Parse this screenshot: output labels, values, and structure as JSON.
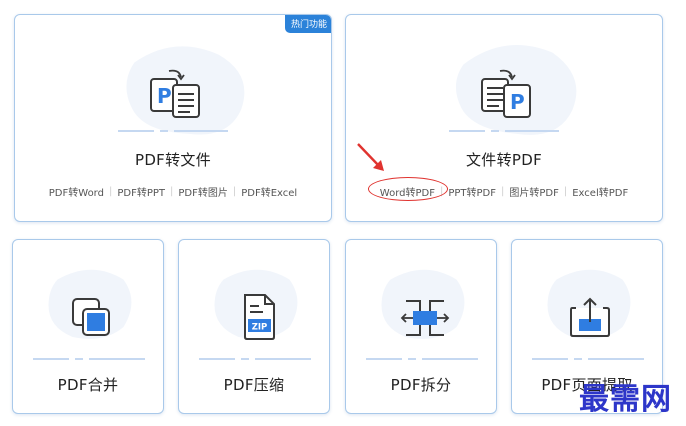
{
  "cards": {
    "pdf_to_file": {
      "badge": "热门功能",
      "title": "PDF转文件",
      "sub_links": [
        "PDF转Word",
        "PDF转PPT",
        "PDF转图片",
        "PDF转Excel"
      ]
    },
    "file_to_pdf": {
      "title": "文件转PDF",
      "sub_links": [
        "Word转PDF",
        "PPT转PDF",
        "图片转PDF",
        "Excel转PDF"
      ]
    },
    "pdf_merge": {
      "title": "PDF合并"
    },
    "pdf_compress": {
      "title": "PDF压缩",
      "icon_label": "ZIP"
    },
    "pdf_split": {
      "title": "PDF拆分"
    },
    "pdf_extract": {
      "title": "PDF页面提取"
    }
  },
  "annotation": {
    "highlighted_link": "Word转PDF",
    "color": "#e0332f"
  },
  "watermark": "最需网",
  "colors": {
    "accent": "#2b82d9",
    "icon_blue": "#2f7de1",
    "card_border": "#a9c9ea",
    "icon_stroke": "#3a3a3a"
  }
}
